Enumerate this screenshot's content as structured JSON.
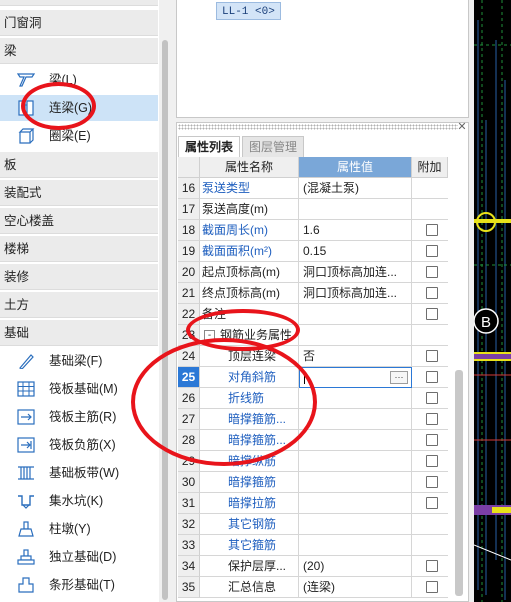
{
  "tree": {
    "categories": [
      "门窗洞",
      "梁",
      "板",
      "装配式",
      "空心楼盖",
      "楼梯",
      "装修",
      "土方",
      "基础"
    ],
    "beam_items": [
      {
        "label": "梁(L)",
        "icon": "beam-icon"
      },
      {
        "label": "连梁(G)",
        "icon": "coupling-beam-icon"
      },
      {
        "label": "圈梁(E)",
        "icon": "ring-beam-icon"
      }
    ],
    "foundation_items": [
      {
        "label": "基础梁(F)",
        "icon": "foundation-beam-icon"
      },
      {
        "label": "筏板基础(M)",
        "icon": "raft-foundation-icon"
      },
      {
        "label": "筏板主筋(R)",
        "icon": "raft-main-rebar-icon"
      },
      {
        "label": "筏板负筋(X)",
        "icon": "raft-negative-rebar-icon"
      },
      {
        "label": "基础板带(W)",
        "icon": "foundation-strip-icon"
      },
      {
        "label": "集水坑(K)",
        "icon": "sump-pit-icon"
      },
      {
        "label": "柱墩(Y)",
        "icon": "column-pier-icon"
      },
      {
        "label": "独立基础(D)",
        "icon": "isolated-footing-icon"
      },
      {
        "label": "条形基础(T)",
        "icon": "strip-footing-icon"
      }
    ]
  },
  "preview": {
    "tag": "LL-1 <0>"
  },
  "panel": {
    "tabs": [
      "属性列表",
      "图层管理"
    ],
    "headers": {
      "name": "属性名称",
      "value": "属性值",
      "extra": "附加"
    },
    "rows": [
      {
        "num": "16",
        "name": "泵送类型",
        "value": "(混凝土泵)",
        "name_color": "blue",
        "checkbox": false
      },
      {
        "num": "17",
        "name": "泵送高度(m)",
        "value": "",
        "name_color": "normal",
        "checkbox": false
      },
      {
        "num": "18",
        "name": "截面周长(m)",
        "value": "1.6",
        "name_color": "blue",
        "value_color": "gray",
        "checkbox": true
      },
      {
        "num": "19",
        "name": "截面面积(m²)",
        "value": "0.15",
        "name_color": "blue",
        "value_color": "gray",
        "checkbox": true
      },
      {
        "num": "20",
        "name": "起点顶标高(m)",
        "value": "洞口顶标高加连...",
        "name_color": "normal",
        "checkbox": true
      },
      {
        "num": "21",
        "name": "终点顶标高(m)",
        "value": "洞口顶标高加连...",
        "name_color": "normal",
        "checkbox": true
      },
      {
        "num": "22",
        "name": "备注",
        "value": "",
        "name_color": "normal",
        "checkbox": true
      },
      {
        "num": "23",
        "name": "钢筋业务属性",
        "value": "",
        "name_color": "normal",
        "checkbox": false,
        "group": true,
        "toggle": "-"
      },
      {
        "num": "24",
        "name": "顶层连梁",
        "value": "否",
        "name_color": "normal",
        "indent": true,
        "checkbox": true
      },
      {
        "num": "25",
        "name": "对角斜筋",
        "value": "",
        "name_color": "blue",
        "indent": true,
        "checkbox": true,
        "active": true,
        "button": "···"
      },
      {
        "num": "26",
        "name": "折线筋",
        "value": "",
        "name_color": "blue",
        "indent": true,
        "checkbox": true
      },
      {
        "num": "27",
        "name": "暗撑箍筋...",
        "value": "",
        "name_color": "blue",
        "indent": true,
        "checkbox": true
      },
      {
        "num": "28",
        "name": "暗撑箍筋...",
        "value": "",
        "name_color": "blue",
        "indent": true,
        "checkbox": true
      },
      {
        "num": "29",
        "name": "暗撑纵筋",
        "value": "",
        "name_color": "blue",
        "indent": true,
        "checkbox": true
      },
      {
        "num": "30",
        "name": "暗撑箍筋",
        "value": "",
        "name_color": "blue",
        "indent": true,
        "checkbox": true
      },
      {
        "num": "31",
        "name": "暗撑拉筋",
        "value": "",
        "name_color": "blue",
        "indent": true,
        "checkbox": true
      },
      {
        "num": "32",
        "name": "其它钢筋",
        "value": "",
        "name_color": "blue",
        "indent": true,
        "checkbox": false
      },
      {
        "num": "33",
        "name": "其它箍筋",
        "value": "",
        "name_color": "blue",
        "indent": true,
        "checkbox": false
      },
      {
        "num": "34",
        "name": "保护层厚...",
        "value": "(20)",
        "name_color": "normal",
        "indent": true,
        "checkbox": true
      },
      {
        "num": "35",
        "name": "汇总信息",
        "value": "(连梁)",
        "name_color": "normal",
        "indent": true,
        "checkbox": true
      }
    ]
  },
  "cad": {
    "marker": "B"
  },
  "colors": {
    "annotation": "#e8141b",
    "selection": "#cde3f7",
    "active_row": "#2b78d6",
    "link_text": "#1f5fbf"
  }
}
